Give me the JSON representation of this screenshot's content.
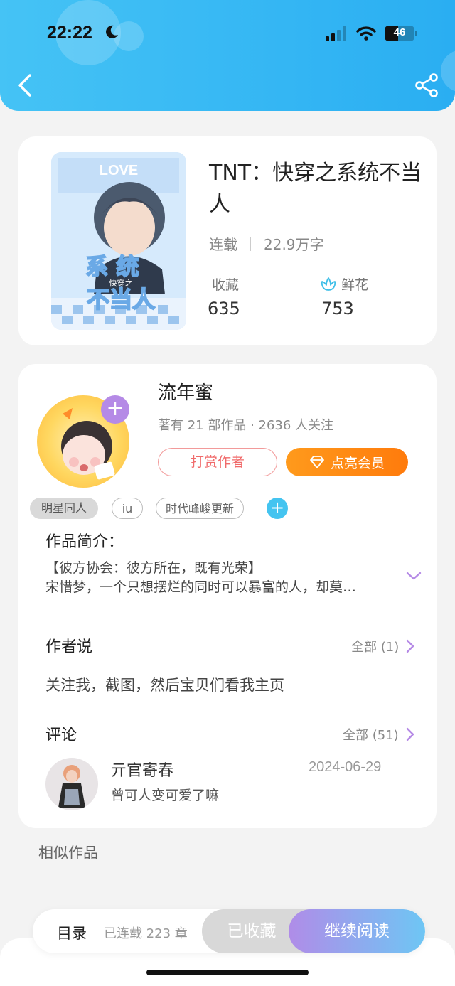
{
  "status_bar": {
    "time": "22:22",
    "battery": "46",
    "battery_level": 0.46
  },
  "book": {
    "title": "TNT：快穿之系统不当人",
    "status": "连载",
    "word_count": "22.9万字",
    "favorites_label": "收藏",
    "favorites_value": "635",
    "flowers_label": "鲜花",
    "flowers_value": "753",
    "cover_text": {
      "top": "LOVE",
      "line1": "系 统",
      "small": "快穿之",
      "line2": "不当人"
    }
  },
  "author": {
    "name": "流年蜜",
    "stats": "著有 21 部作品 · 2636 人关注",
    "tip_label": "打赏作者",
    "vip_label": "点亮会员"
  },
  "tags": [
    "明星同人",
    "iu",
    "时代峰峻更新"
  ],
  "intro": {
    "title": "作品简介：",
    "line1": "【彼方协会：彼方所在，既有光荣】",
    "line2": "宋惜梦，一个只想摆烂的同时可以暴富的人，却莫…"
  },
  "author_notes": {
    "title": "作者说",
    "all_label": "全部 (1)",
    "text": "关注我，截图，然后宝贝们看我主页"
  },
  "comments": {
    "title": "评论",
    "all_label": "全部 (51)",
    "items": [
      {
        "user": "亓官寄春",
        "date": "2024-06-29",
        "text": "曾可人变可爱了嘛"
      }
    ]
  },
  "similar_title": "相似作品",
  "bottom_bar": {
    "toc_label": "目录",
    "chapters": "已连载 223 章",
    "collected_label": "已收藏",
    "continue_label": "继续阅读"
  },
  "colors": {
    "header": "#2aaef2",
    "accent_purple": "#b58ae6",
    "vip_orange": "#ff8a14",
    "tip_red": "#f06b6b"
  },
  "icons": [
    "back-icon",
    "share-icon",
    "flower-icon",
    "diamond-icon",
    "chevron-down-icon",
    "chevron-right-icon",
    "plus-icon",
    "moon-icon"
  ]
}
